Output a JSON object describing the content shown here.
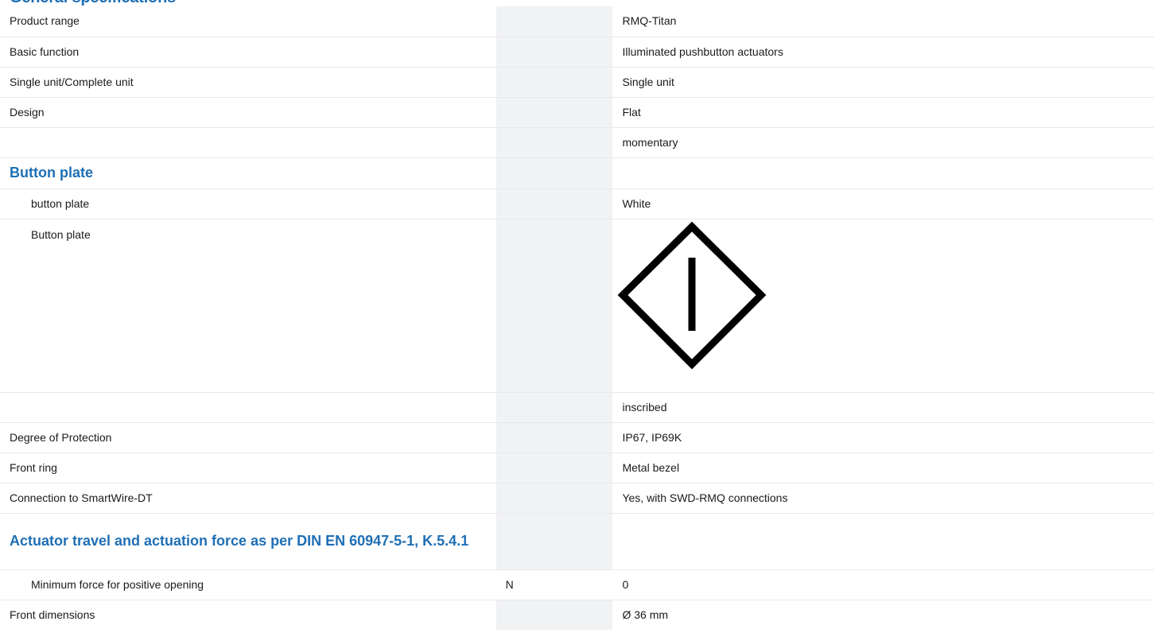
{
  "heading_partial": "General specifications",
  "rows": [
    {
      "label": "Product range",
      "unit": "",
      "value": "RMQ-Titan"
    },
    {
      "label": "Basic function",
      "unit": "",
      "value": "Illuminated pushbutton actuators"
    },
    {
      "label": "Single unit/Complete unit",
      "unit": "",
      "value": "Single unit"
    },
    {
      "label": "Design",
      "unit": "",
      "value": "Flat"
    },
    {
      "label": "",
      "unit": "",
      "value": "momentary"
    },
    {
      "section": "Button plate"
    },
    {
      "label": "button plate",
      "unit": "",
      "value": "White",
      "indent": true
    },
    {
      "label": "Button plate",
      "unit": "",
      "value_icon": "diamond-with-vertical-bar-icon",
      "indent": true
    },
    {
      "label": "",
      "unit": "",
      "value": "inscribed"
    },
    {
      "label": "Degree of Protection",
      "unit": "",
      "value": "IP67, IP69K"
    },
    {
      "label": "Front ring",
      "unit": "",
      "value": "Metal bezel"
    },
    {
      "label": "Connection to SmartWire-DT",
      "unit": "",
      "value": "Yes, with SWD-RMQ connections"
    },
    {
      "section": "Actuator travel and actuation force as per DIN EN 60947-5-1, K.5.4.1"
    },
    {
      "label": "Minimum force for positive opening",
      "unit": "N",
      "value": "0",
      "indent": true
    },
    {
      "label": "Front dimensions",
      "unit": "",
      "value": "Ø 36 mm"
    }
  ],
  "colors": {
    "accent": "#1f6fb5",
    "unit_column_bg": "#f1f2f4",
    "row_divider": "#e6e8eb"
  }
}
